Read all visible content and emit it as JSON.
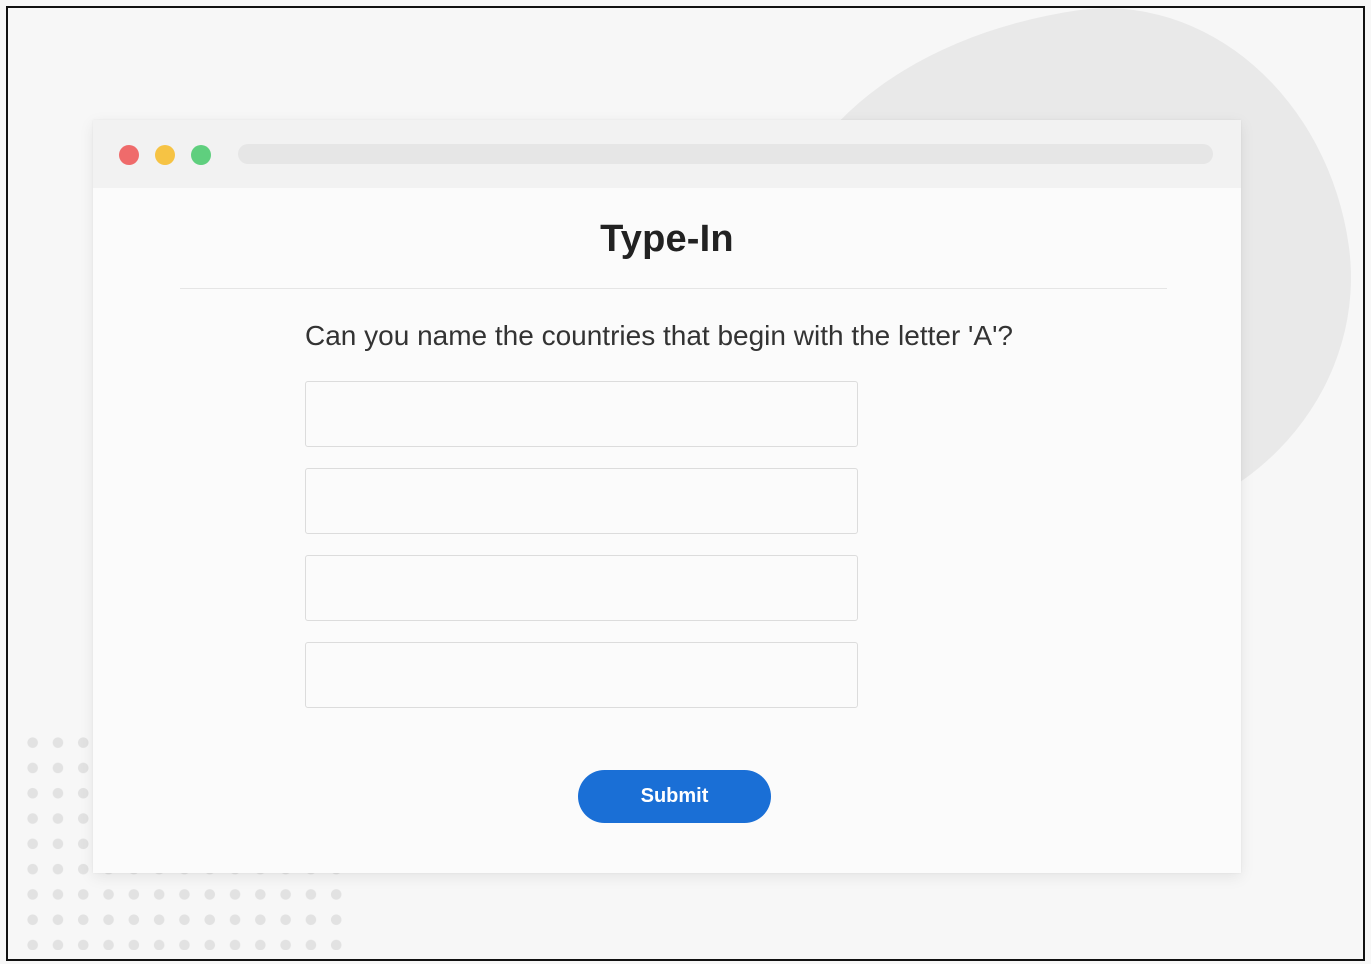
{
  "page": {
    "title": "Type-In",
    "question": "Can you name the countries that begin with the letter 'A'?"
  },
  "answers": [
    {
      "value": "",
      "placeholder": ""
    },
    {
      "value": "",
      "placeholder": ""
    },
    {
      "value": "",
      "placeholder": ""
    },
    {
      "value": "",
      "placeholder": ""
    }
  ],
  "actions": {
    "submit_label": "Submit"
  },
  "colors": {
    "accent": "#1a6fd6",
    "traffic_red": "#ef6b6b",
    "traffic_yellow": "#f6c344",
    "traffic_green": "#5fcf7e"
  }
}
